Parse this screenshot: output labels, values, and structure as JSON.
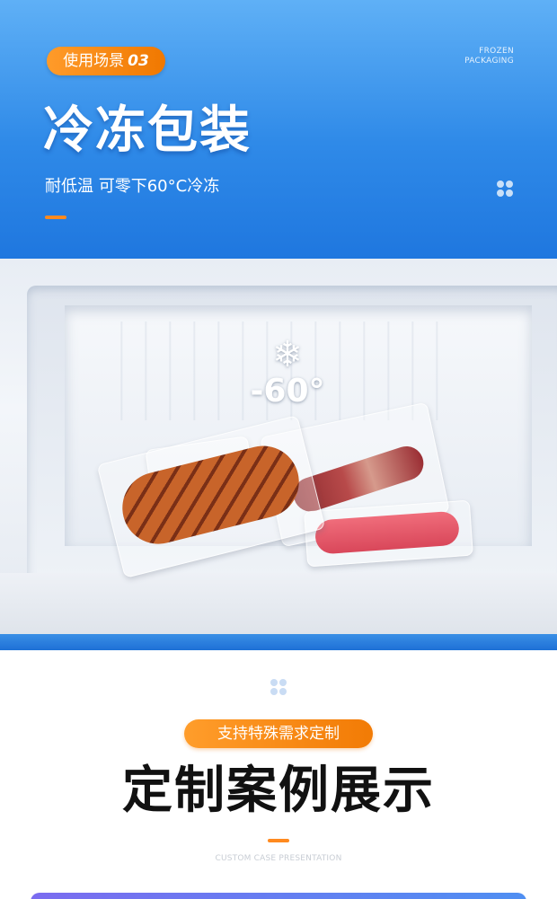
{
  "hero": {
    "badge_text": "使用场景",
    "badge_num": "03",
    "en_line1": "FROZEN",
    "en_line2": "PACKAGING",
    "title_bold": "冷冻",
    "title_light": "包装",
    "subtitle": "耐低温  可零下60°C冷冻"
  },
  "photo": {
    "temp_icon": "❄",
    "temp_label": "-60°"
  },
  "custom": {
    "badge_text": "支持特殊需求定制",
    "title": "定制案例展示",
    "en_subtitle": "CUSTOM CASE PRESENTATION"
  },
  "colors": {
    "hero_blue": "#2f8ae8",
    "accent_orange": "#f07800"
  },
  "icons": {
    "hero_decoration": "clover-icon",
    "temperature": "snowflake-icon",
    "lower_decoration": "clover-icon"
  }
}
